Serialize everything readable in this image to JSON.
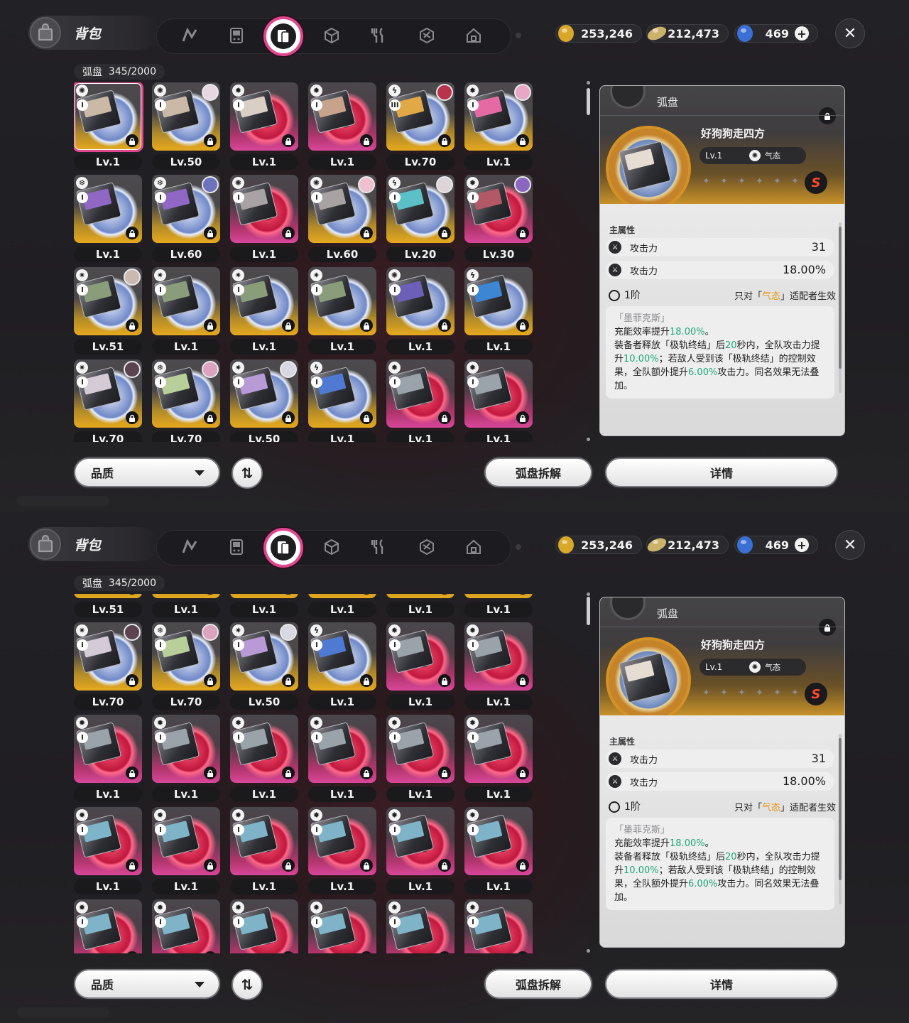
{
  "header": {
    "bag_title": "背包",
    "currency": [
      {
        "name": "gold-coin",
        "value": "253,246"
      },
      {
        "name": "ticket",
        "value": "212,473"
      },
      {
        "name": "polychrome",
        "value": "469"
      }
    ],
    "close_symbol": "✕"
  },
  "inventory": {
    "label": "弧盘",
    "count": "345/2000"
  },
  "colors": {
    "accent": "#e0468c",
    "gold": "#e6a91e",
    "pink": "#d8479a",
    "green": "#1ea978",
    "orange": "#e9961a"
  },
  "grid_top": [
    {
      "lv": "Lv.1",
      "rarity": "gold",
      "attr": "ether",
      "rank": "I",
      "sel": true,
      "art": "#c9b9a6"
    },
    {
      "lv": "Lv.50",
      "rarity": "gold",
      "attr": "ether",
      "rank": "I",
      "avatar": "#e6d7e0",
      "art": "#c9b9a6"
    },
    {
      "lv": "Lv.1",
      "rarity": "pink",
      "attr": "physical",
      "rank": "I",
      "art": "#d9cfc5"
    },
    {
      "lv": "Lv.1",
      "rarity": "pink",
      "attr": "physical",
      "rank": "I",
      "art": "#c7a38c"
    },
    {
      "lv": "Lv.70",
      "rarity": "gold",
      "attr": "electric",
      "rank": "III",
      "avatar": "#b9334d",
      "art": "#e0a847"
    },
    {
      "lv": "Lv.1",
      "rarity": "gold",
      "attr": "physical",
      "rank": "I",
      "avatar": "#e8a7c4",
      "art": "#e56aa3"
    },
    {
      "lv": "Lv.1",
      "rarity": "gold",
      "attr": "ice",
      "rank": "I",
      "art": "#9167c6"
    },
    {
      "lv": "Lv.60",
      "rarity": "gold",
      "attr": "ice",
      "rank": "I",
      "avatar": "#6a73bb",
      "art": "#9167c6"
    },
    {
      "lv": "Lv.1",
      "rarity": "pink",
      "attr": "ether",
      "rank": "I",
      "art": "#a8a2a2"
    },
    {
      "lv": "Lv.60",
      "rarity": "gold",
      "attr": "ether",
      "rank": "I",
      "avatar": "#f0c0cf",
      "art": "#a8a2a2"
    },
    {
      "lv": "Lv.20",
      "rarity": "gold",
      "attr": "electric",
      "rank": "I",
      "avatar": "#dcd4d6",
      "art": "#5bc1c7"
    },
    {
      "lv": "Lv.30",
      "rarity": "pink",
      "attr": "physical",
      "rank": "I",
      "avatar": "#8c67c2",
      "art": "#b25866"
    },
    {
      "lv": "Lv.51",
      "rarity": "gold",
      "attr": "fire",
      "rank": "I",
      "avatar": "#cbb8b0",
      "art": "#8a9d7a"
    },
    {
      "lv": "Lv.1",
      "rarity": "gold",
      "attr": "fire",
      "rank": "I",
      "art": "#8a9d7a"
    },
    {
      "lv": "Lv.1",
      "rarity": "gold",
      "attr": "fire",
      "rank": "I",
      "art": "#8a9d7a"
    },
    {
      "lv": "Lv.1",
      "rarity": "gold",
      "attr": "fire",
      "rank": "I",
      "art": "#8a9d7a"
    },
    {
      "lv": "Lv.1",
      "rarity": "gold",
      "attr": "ether",
      "rank": "I",
      "art": "#6c5fb7"
    },
    {
      "lv": "Lv.1",
      "rarity": "gold",
      "attr": "electric",
      "rank": "I",
      "art": "#3d86d4"
    },
    {
      "lv": "Lv.70",
      "rarity": "gold",
      "attr": "fire",
      "rank": "I",
      "avatar": "#5b4450",
      "art": "#d4cbd6"
    },
    {
      "lv": "Lv.70",
      "rarity": "gold",
      "attr": "ice",
      "rank": "I",
      "avatar": "#dba3be",
      "art": "#b8cf9a"
    },
    {
      "lv": "Lv.50",
      "rarity": "gold",
      "attr": "fire",
      "rank": "I",
      "avatar": "#d8d8e2",
      "art": "#b89ad6"
    },
    {
      "lv": "Lv.1",
      "rarity": "gold",
      "attr": "electric",
      "rank": "I",
      "art": "#4f7ad4"
    },
    {
      "lv": "Lv.1",
      "rarity": "pink",
      "attr": "physical",
      "rank": "I",
      "art": "#9ba3aa"
    },
    {
      "lv": "Lv.1",
      "rarity": "pink",
      "attr": "physical",
      "rank": "I",
      "art": "#9ba3aa"
    }
  ],
  "grid_bottom": [
    {
      "lv": "Lv.51",
      "rarity": "gold",
      "attr": "fire",
      "rank": "I",
      "art": "#8a9d7a"
    },
    {
      "lv": "Lv.1",
      "rarity": "gold",
      "attr": "fire",
      "rank": "I",
      "art": "#8a9d7a"
    },
    {
      "lv": "Lv.1",
      "rarity": "gold",
      "attr": "fire",
      "rank": "I",
      "art": "#8a9d7a"
    },
    {
      "lv": "Lv.1",
      "rarity": "gold",
      "attr": "fire",
      "rank": "I",
      "art": "#8a9d7a"
    },
    {
      "lv": "Lv.1",
      "rarity": "gold",
      "attr": "ether",
      "rank": "I",
      "art": "#6c5fb7"
    },
    {
      "lv": "Lv.1",
      "rarity": "gold",
      "attr": "electric",
      "rank": "I",
      "art": "#3d86d4"
    },
    {
      "lv": "Lv.70",
      "rarity": "gold",
      "attr": "fire",
      "rank": "I",
      "avatar": "#5b4450",
      "art": "#d4cbd6"
    },
    {
      "lv": "Lv.70",
      "rarity": "gold",
      "attr": "ice",
      "rank": "I",
      "avatar": "#dba3be",
      "art": "#b8cf9a"
    },
    {
      "lv": "Lv.50",
      "rarity": "gold",
      "attr": "fire",
      "rank": "I",
      "avatar": "#d8d8e2",
      "art": "#b89ad6"
    },
    {
      "lv": "Lv.1",
      "rarity": "gold",
      "attr": "electric",
      "rank": "I",
      "art": "#4f7ad4"
    },
    {
      "lv": "Lv.1",
      "rarity": "pink",
      "attr": "physical",
      "rank": "I",
      "art": "#9ba3aa"
    },
    {
      "lv": "Lv.1",
      "rarity": "pink",
      "attr": "physical",
      "rank": "I",
      "art": "#9ba3aa"
    },
    {
      "lv": "Lv.1",
      "rarity": "pink",
      "attr": "physical",
      "rank": "I",
      "art": "#9ba3aa"
    },
    {
      "lv": "Lv.1",
      "rarity": "pink",
      "attr": "physical",
      "rank": "I",
      "art": "#9ba3aa"
    },
    {
      "lv": "Lv.1",
      "rarity": "pink",
      "attr": "physical",
      "rank": "I",
      "art": "#9ba3aa"
    },
    {
      "lv": "Lv.1",
      "rarity": "pink",
      "attr": "physical",
      "rank": "I",
      "art": "#9ba3aa"
    },
    {
      "lv": "Lv.1",
      "rarity": "pink",
      "attr": "physical",
      "rank": "I",
      "art": "#9ba3aa"
    },
    {
      "lv": "Lv.1",
      "rarity": "pink",
      "attr": "physical",
      "rank": "I",
      "art": "#9ba3aa"
    },
    {
      "lv": "Lv.1",
      "rarity": "pink",
      "attr": "physical",
      "rank": "I",
      "art": "#7fb3c8"
    },
    {
      "lv": "Lv.1",
      "rarity": "pink",
      "attr": "physical",
      "rank": "I",
      "art": "#7fb3c8"
    },
    {
      "lv": "Lv.1",
      "rarity": "pink",
      "attr": "physical",
      "rank": "I",
      "art": "#7fb3c8"
    },
    {
      "lv": "Lv.1",
      "rarity": "pink",
      "attr": "physical",
      "rank": "I",
      "art": "#7fb3c8"
    },
    {
      "lv": "Lv.1",
      "rarity": "pink",
      "attr": "physical",
      "rank": "I",
      "art": "#7fb3c8"
    },
    {
      "lv": "Lv.1",
      "rarity": "pink",
      "attr": "physical",
      "rank": "I",
      "art": "#7fb3c8"
    },
    {
      "lv": "",
      "rarity": "pink",
      "attr": "physical",
      "rank": "I",
      "art": "#7fb3c8"
    },
    {
      "lv": "",
      "rarity": "pink",
      "attr": "physical",
      "rank": "I",
      "art": "#7fb3c8"
    },
    {
      "lv": "",
      "rarity": "pink",
      "attr": "physical",
      "rank": "I",
      "art": "#7fb3c8"
    },
    {
      "lv": "",
      "rarity": "pink",
      "attr": "physical",
      "rank": "I",
      "art": "#7fb3c8"
    },
    {
      "lv": "",
      "rarity": "pink",
      "attr": "physical",
      "rank": "I",
      "art": "#7fb3c8"
    },
    {
      "lv": "",
      "rarity": "pink",
      "attr": "physical",
      "rank": "I",
      "art": "#7fb3c8"
    }
  ],
  "detail": {
    "kind": "弧盘",
    "name": "好狗狗走四方",
    "level": "Lv.1",
    "attribute": "气态",
    "rank_letter": "S",
    "main_stat_title": "主属性",
    "stats": [
      {
        "name": "攻击力",
        "value": "31"
      },
      {
        "name": "攻击力",
        "value": "18.00%"
      }
    ],
    "tier": "1阶",
    "condition_pre": "只对「",
    "condition_hl": "气态",
    "condition_post": "」适配者生效",
    "effect_name": "「墨菲克斯」",
    "effect_lines": [
      [
        {
          "t": "充能效率提升"
        },
        {
          "t": "18.00%",
          "g": true
        },
        {
          "t": "。"
        }
      ],
      [
        {
          "t": "装备者释放「极轨终结」后"
        },
        {
          "t": "20",
          "g": true
        },
        {
          "t": "秒内，全队攻击力提升"
        },
        {
          "t": "10.00%",
          "g": true
        },
        {
          "t": "；若敌人受到该「极轨终结」的控制效果，全队额外提升"
        },
        {
          "t": "6.00%",
          "g": true
        },
        {
          "t": "攻击力。同名效果无法叠加。"
        }
      ]
    ]
  },
  "footer": {
    "quality": "品质",
    "sort_symbol": "⇅",
    "dismantle": "弧盘拆解",
    "details": "详情"
  }
}
